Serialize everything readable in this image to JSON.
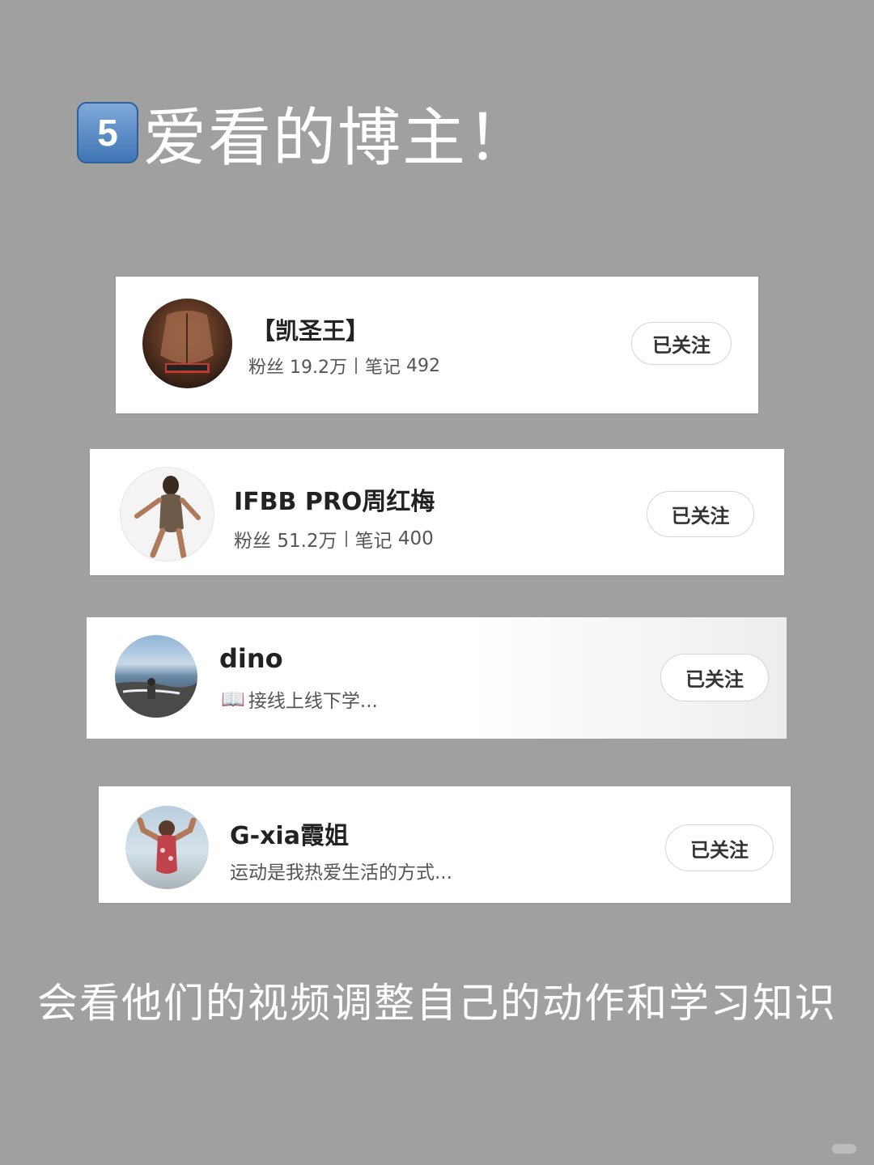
{
  "heading": {
    "number": "5",
    "title": "爱看的博主！"
  },
  "bloggers": [
    {
      "name": "【凯圣王】",
      "fans_label": "粉丝",
      "fans": "19.2万",
      "notes_label": "笔记",
      "notes": "492",
      "follow_label": "已关注"
    },
    {
      "name": "IFBB PRO周红梅",
      "fans_label": "粉丝",
      "fans": "51.2万",
      "notes_label": "笔记",
      "notes": "400",
      "follow_label": "已关注"
    },
    {
      "name": "dino",
      "bio_icon": "open-book-icon",
      "bio": "接线上线下学...",
      "follow_label": "已关注"
    },
    {
      "name": "G-xia霞姐",
      "bio": "运动是我热爱生活的方式...",
      "follow_label": "已关注"
    }
  ],
  "caption": "会看他们的视频调整自己的动作和学习知识",
  "colors": {
    "background": "#a0a0a0",
    "card": "#ffffff",
    "badge": "#3f75b5",
    "text": "#222222"
  }
}
